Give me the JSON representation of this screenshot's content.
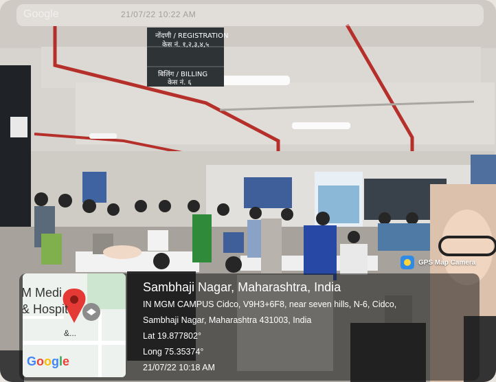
{
  "top_bar": {
    "ghost_text": "Google",
    "ghost_datetime": "21/07/22 10:22 AM"
  },
  "signage": {
    "line1": "नोंदणी / REGISTRATION",
    "line2": "केस नं. १,२,३,४,५",
    "line3": "बिलिंग / BILLING",
    "line4": "केस नं. ६"
  },
  "gps_overlay": {
    "location_title": "Sambhaji Nagar, Maharashtra, India",
    "address_line1": "IN MGM CAMPUS Cidco, V9H3+6F8, near seven hills, N-6, Cidco,",
    "address_line2": "Sambhaji Nagar, Maharashtra 431003, India",
    "latitude": "Lat 19.877802°",
    "longitude": "Long 75.35374°",
    "timestamp": "21/07/22 10:18 AM"
  },
  "map_thumb": {
    "label1": "M Medi",
    "label2": "& Hospit",
    "label3": "&...",
    "google": "Google"
  },
  "camera_badge": {
    "label": "GPS Map Camera"
  },
  "colors": {
    "overlay_bg": "#191919",
    "badge_bg": "#2f8be6",
    "pin_red": "#e53935",
    "google_blue": "#4285F4",
    "google_red": "#EA4335",
    "google_yellow": "#FBBC05",
    "google_green": "#34A853"
  }
}
